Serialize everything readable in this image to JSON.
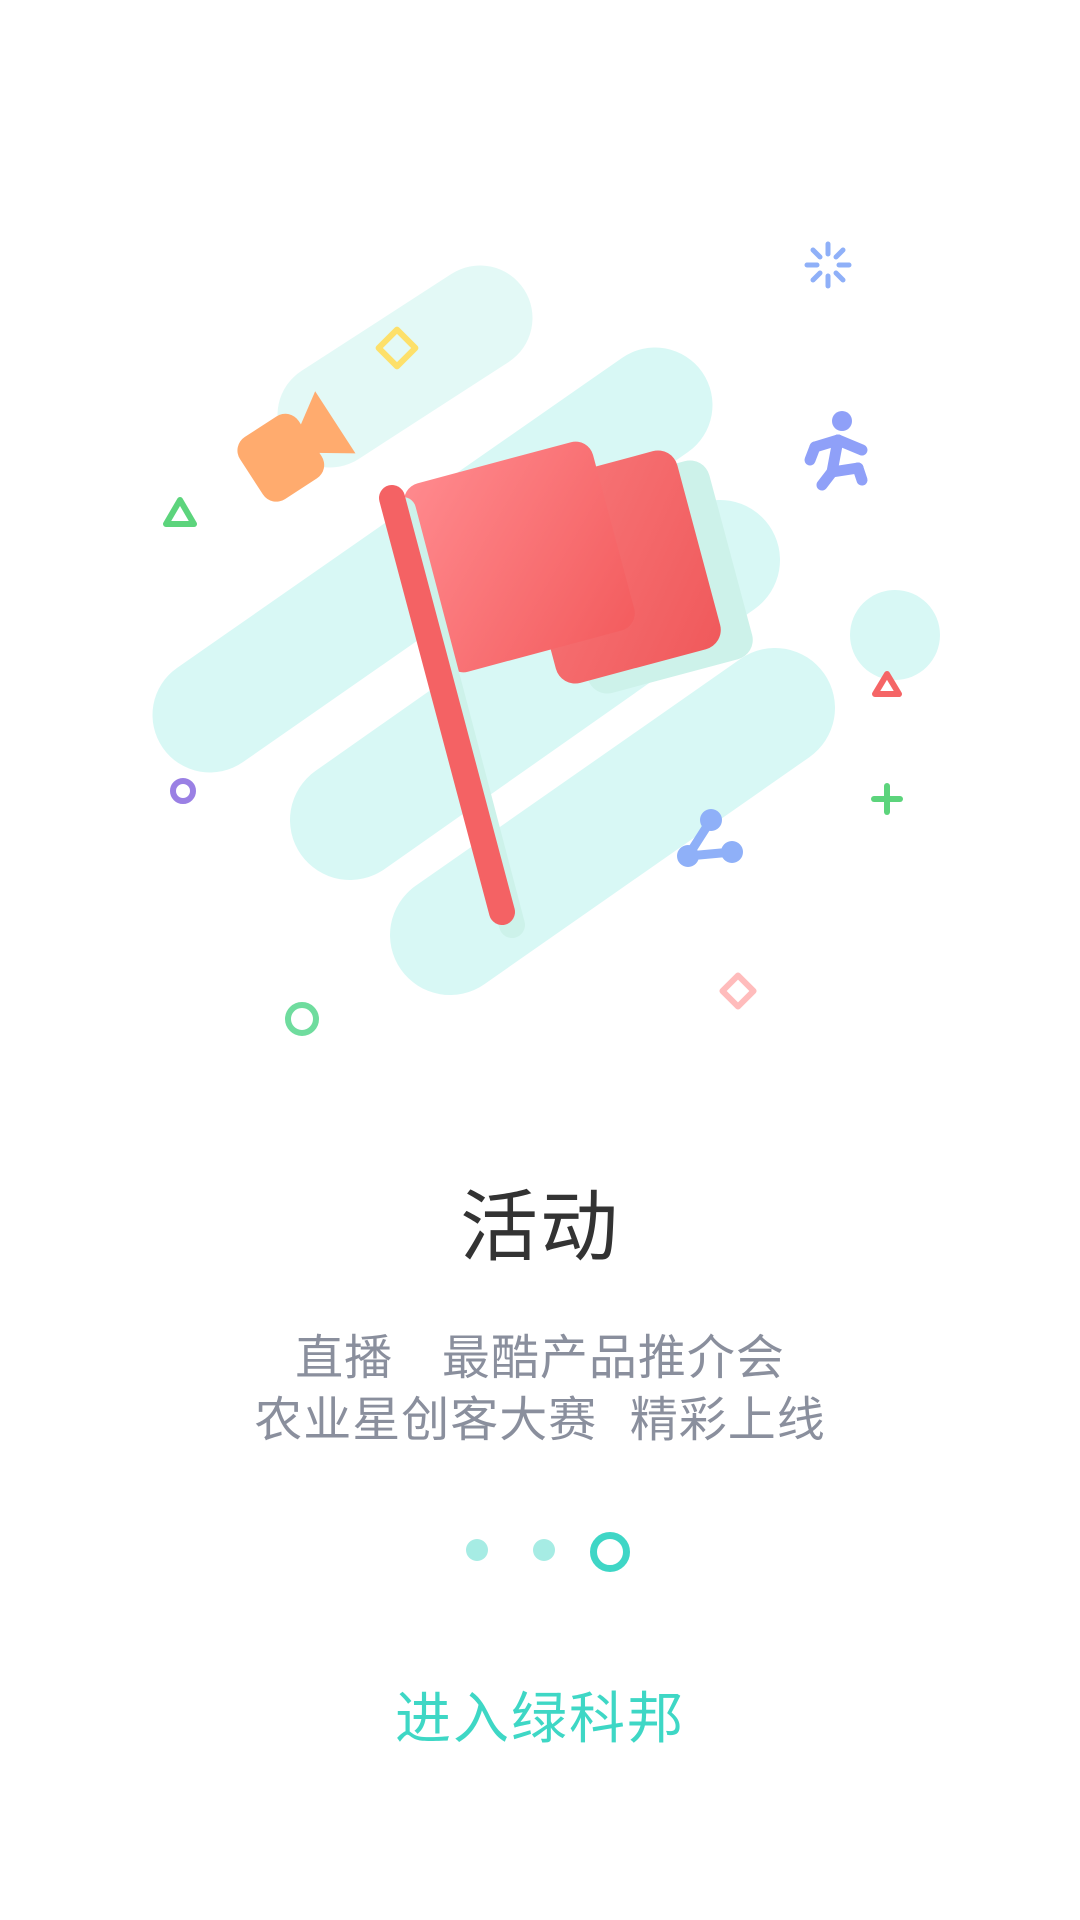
{
  "slide": {
    "title": "活动",
    "subtitle_line1": "直播   最酷产品推介会",
    "subtitle_line2": "农业星创客大赛  精彩上线"
  },
  "pager": {
    "total": 3,
    "active_index": 2
  },
  "enter_button": {
    "label": "进入绿科邦"
  },
  "colors": {
    "accent": "#3ed7c5",
    "flag": "#f56566",
    "background_blob": "#d8f8f5",
    "title": "#333333",
    "subtitle": "#8a8f9d"
  },
  "icons": [
    "flag-icon",
    "video-camera-icon",
    "running-man-icon",
    "share-icon",
    "sparkle-icon"
  ]
}
